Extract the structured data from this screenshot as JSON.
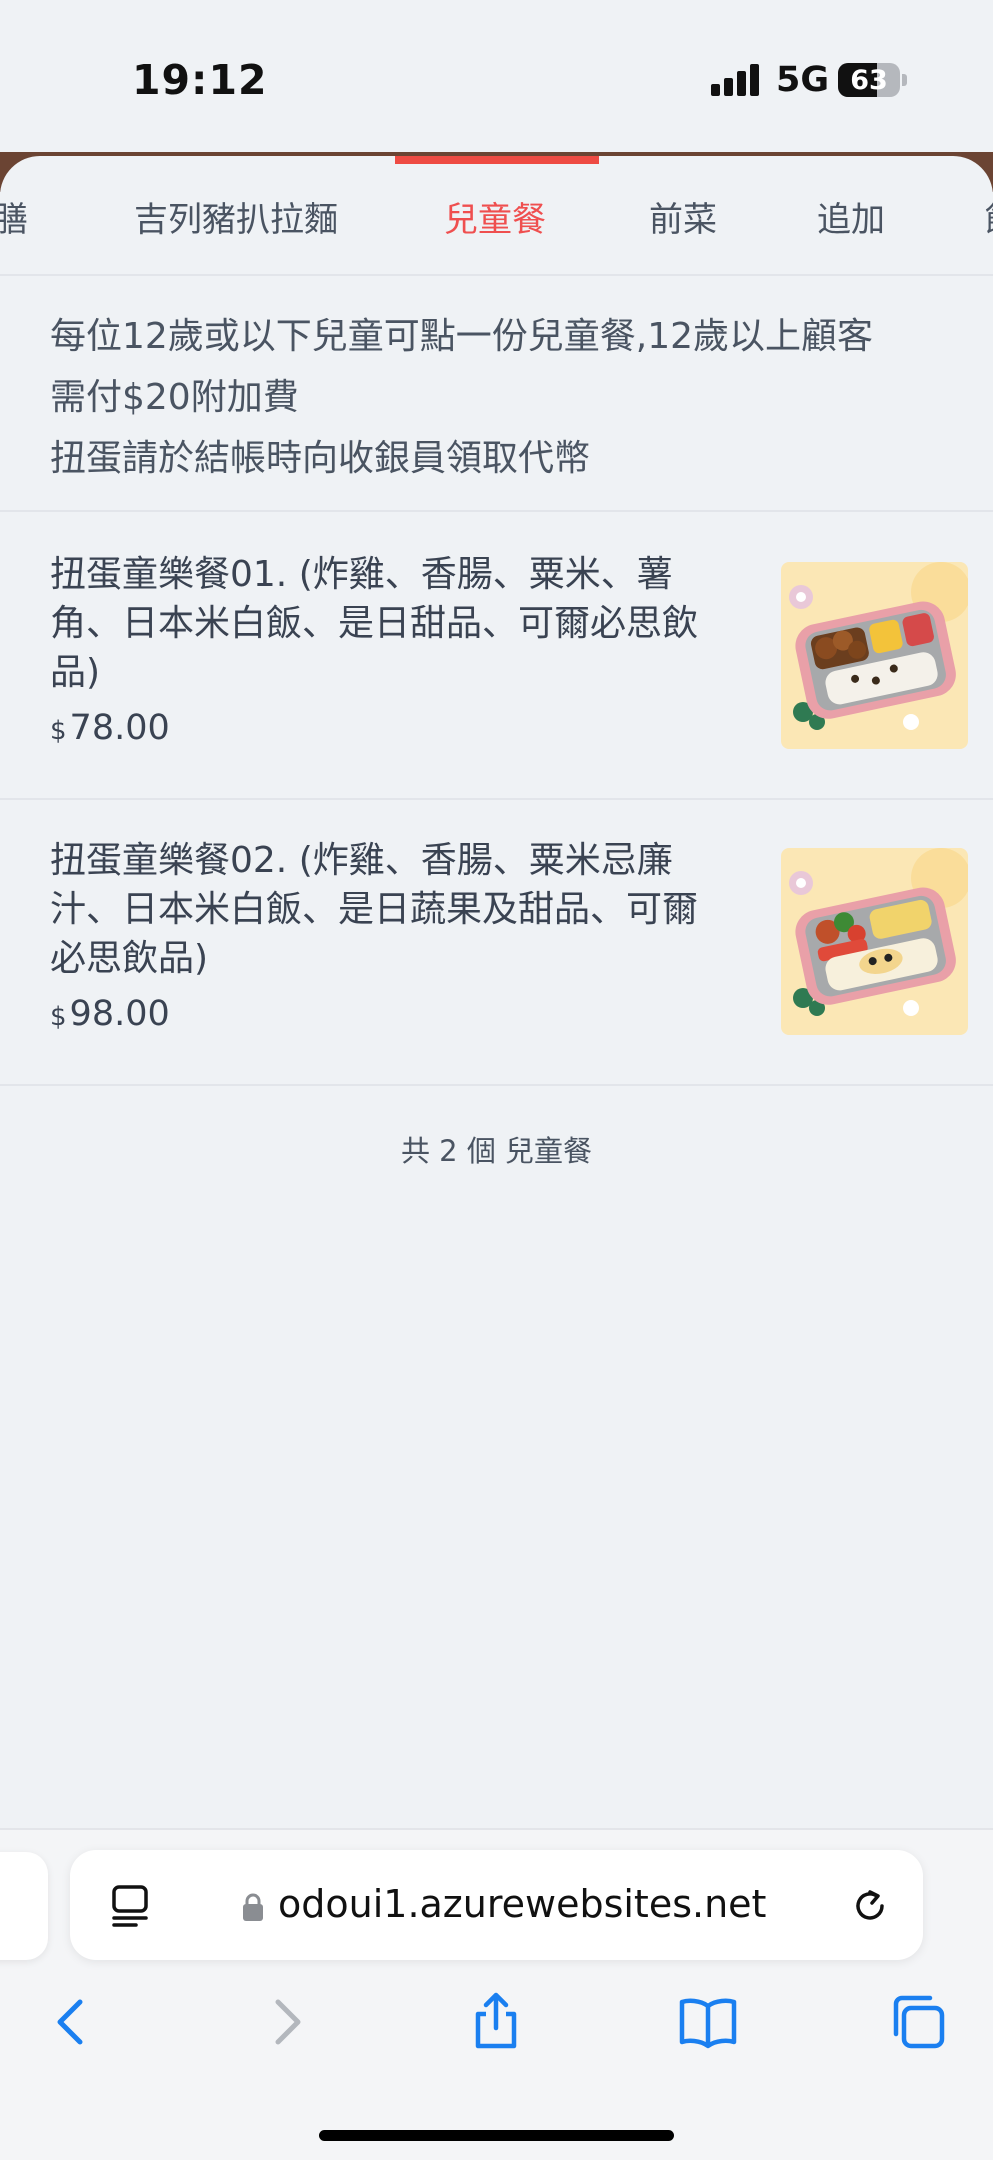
{
  "status": {
    "time": "19:12",
    "network": "5G",
    "battery": "63"
  },
  "tabs": [
    {
      "label": "膳",
      "active": false
    },
    {
      "label": "吉列豬扒拉麵",
      "active": false
    },
    {
      "label": "兒童餐",
      "active": true
    },
    {
      "label": "前菜",
      "active": false
    },
    {
      "label": "追加",
      "active": false
    },
    {
      "label": "飯",
      "active": false
    }
  ],
  "notice": {
    "line1": "每位12歲或以下兒童可點一份兒童餐,12歲以上顧客",
    "line2": "需付$20附加費",
    "line3": "扭蛋請於結帳時向收銀員領取代幣"
  },
  "items": [
    {
      "name": "扭蛋童樂餐01. (炸雞、香腸、粟米、薯角、日本米白飯、是日甜品、可爾必思飲品)",
      "currency": "$",
      "price": "78.00"
    },
    {
      "name": "扭蛋童樂餐02. (炸雞、香腸、粟米忌廉汁、日本米白飯、是日蔬果及甜品、可爾必思飲品)",
      "currency": "$",
      "price": "98.00"
    }
  ],
  "footer": {
    "count_text": "共 2 個 兒童餐"
  },
  "browser": {
    "url": "odoui1.azurewebsites.net"
  },
  "icons": {
    "reader": "reader-mode-icon",
    "lock": "lock-icon",
    "reload": "reload-icon",
    "back": "back-chevron-icon",
    "forward": "forward-chevron-icon",
    "share": "share-icon",
    "bookmarks": "bookmarks-book-icon",
    "tabs": "tabs-icon"
  },
  "colors": {
    "accent": "#ee4b43",
    "ios_blue": "#1a7ff0",
    "background": "#eff2f5"
  }
}
